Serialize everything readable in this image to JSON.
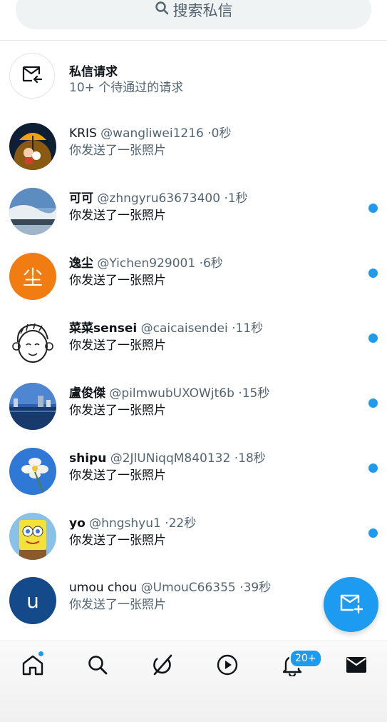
{
  "search": {
    "placeholder": "搜索私信"
  },
  "requests": {
    "title": "私信请求",
    "subtitle": "10+ 个待通过的请求"
  },
  "conversations": [
    {
      "name": "KRIS",
      "handle": "@wangliwei1216",
      "time": "0秒",
      "message": "你发送了一张照片",
      "unread": false
    },
    {
      "name": "可可",
      "handle": "@zhngyru63673400",
      "time": "1秒",
      "message": "你发送了一张照片",
      "unread": true
    },
    {
      "name": "逸尘",
      "handle": "@Yichen929001",
      "time": "6秒",
      "message": "你发送了一张照片",
      "unread": true,
      "avatar_text": "尘"
    },
    {
      "name": "菜菜sensei",
      "handle": "@caicaisendei",
      "time": "11秒",
      "message": "你发送了一张照片",
      "unread": true
    },
    {
      "name": "盧俊傑",
      "handle": "@pilmwubUXOWjt6b",
      "time": "15秒",
      "message": "你发送了一张照片",
      "unread": true
    },
    {
      "name": "shipu",
      "handle": "@2JlUNiqqM840132",
      "time": "18秒",
      "message": "你发送了一张照片",
      "unread": true
    },
    {
      "name": "yo",
      "handle": "@hngshyu1",
      "time": "22秒",
      "message": "你发送了一张照片",
      "unread": true
    },
    {
      "name": "umou chou",
      "handle": "@UmouC66355",
      "time": "39秒",
      "message": "你发送了一张照片",
      "unread": false,
      "avatar_text": "u"
    }
  ],
  "separator": "·",
  "bottom_nav": {
    "items": [
      "home-icon",
      "search-icon",
      "grok-icon",
      "video-icon",
      "bell-icon",
      "mail-icon"
    ],
    "notifications_badge": "20+"
  },
  "colors": {
    "accent": "#1d9bf0",
    "text": "#0f1419",
    "muted": "#536471",
    "orange_avatar": "#f07c12",
    "navy_avatar": "#144a8a"
  }
}
